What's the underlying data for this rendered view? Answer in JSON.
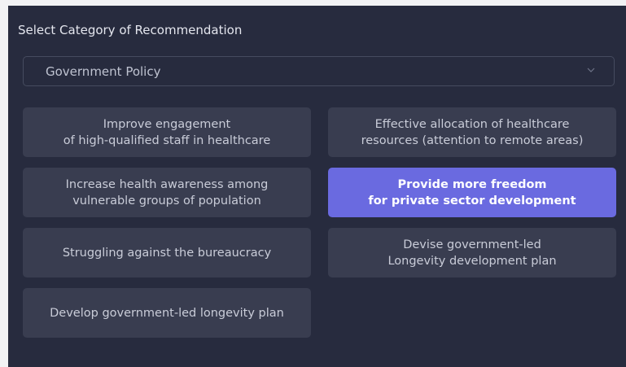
{
  "heading": "Select Category of Recommendation",
  "category_select": {
    "selected": "Government Policy",
    "chevron_icon": "chevron-down-icon"
  },
  "options": [
    {
      "line1": "Improve engagement",
      "line2": "of high-qualified staff in healthcare",
      "selected": false
    },
    {
      "line1": "Effective allocation of healthcare",
      "line2": "resources (attention to remote areas)",
      "selected": false
    },
    {
      "line1": "Increase health awareness among",
      "line2": "vulnerable groups of population",
      "selected": false
    },
    {
      "line1": "Provide more freedom",
      "line2": "for private sector development",
      "selected": true
    },
    {
      "line1": "Struggling against the bureaucracy",
      "line2": "",
      "selected": false
    },
    {
      "line1": "Devise government-led",
      "line2": "Longevity development plan",
      "selected": false
    },
    {
      "line1": "Develop government-led longevity plan",
      "line2": "",
      "selected": false
    }
  ],
  "colors": {
    "panel_bg": "#272b3e",
    "option_bg": "#393d50",
    "selected_bg": "#6a6ae0"
  }
}
